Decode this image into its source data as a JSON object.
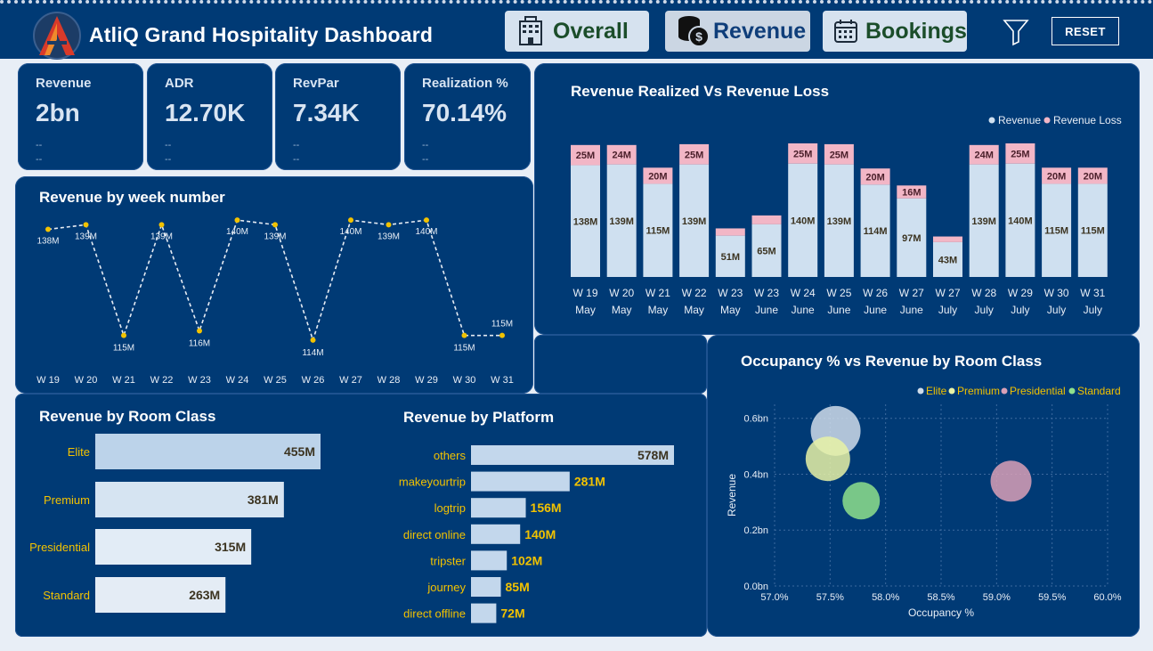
{
  "header": {
    "title": "AtliQ Grand Hospitality Dashboard",
    "nav": [
      {
        "label": "Overall",
        "icon": "hotel-icon"
      },
      {
        "label": "Revenue",
        "icon": "coins-icon"
      },
      {
        "label": "Bookings",
        "icon": "calendar-icon"
      }
    ],
    "reset_label": "RESET"
  },
  "kpis": [
    {
      "label": "Revenue",
      "value": "2bn",
      "sub1": "--",
      "sub2": "--"
    },
    {
      "label": "ADR",
      "value": "12.70K",
      "sub1": "--",
      "sub2": "--"
    },
    {
      "label": "RevPar",
      "value": "7.34K",
      "sub1": "--",
      "sub2": "--"
    },
    {
      "label": "Realization %",
      "value": "70.14%",
      "sub1": "--",
      "sub2": "--"
    }
  ],
  "chart_data": [
    {
      "id": "stacked",
      "type": "bar",
      "title": "Revenue Realized Vs Revenue Loss",
      "legend": [
        "Revenue",
        "Revenue Loss"
      ],
      "legend_colors": [
        "#cfe0f0",
        "#f2b6c6"
      ],
      "categories": [
        [
          "W 19",
          "May"
        ],
        [
          "W 20",
          "May"
        ],
        [
          "W 21",
          "May"
        ],
        [
          "W 22",
          "May"
        ],
        [
          "W 23",
          "May"
        ],
        [
          "W 23",
          "June"
        ],
        [
          "W 24",
          "June"
        ],
        [
          "W 25",
          "June"
        ],
        [
          "W 26",
          "June"
        ],
        [
          "W 27",
          "June"
        ],
        [
          "W 27",
          "July"
        ],
        [
          "W 28",
          "July"
        ],
        [
          "W 29",
          "July"
        ],
        [
          "W 30",
          "July"
        ],
        [
          "W 31",
          "July"
        ]
      ],
      "series": [
        {
          "name": "Revenue",
          "values": [
            138,
            139,
            115,
            139,
            51,
            65,
            140,
            139,
            114,
            97,
            43,
            139,
            140,
            115,
            115
          ],
          "labels": [
            "138M",
            "139M",
            "115M",
            "139M",
            "51M",
            "65M",
            "140M",
            "139M",
            "114M",
            "97M",
            "43M",
            "139M",
            "140M",
            "115M",
            "115M"
          ]
        },
        {
          "name": "Revenue Loss",
          "values": [
            25,
            24,
            20,
            25,
            9,
            11,
            25,
            25,
            20,
            16,
            7,
            24,
            25,
            20,
            20
          ],
          "labels": [
            "25M",
            "24M",
            "20M",
            "25M",
            "",
            "",
            "25M",
            "25M",
            "20M",
            "16M",
            "",
            "24M",
            "25M",
            "20M",
            "20M"
          ]
        }
      ],
      "ylim": [
        0,
        170
      ]
    },
    {
      "id": "weekline",
      "type": "line",
      "title": "Revenue by week number",
      "categories": [
        "W 19",
        "W 20",
        "W 21",
        "W 22",
        "W 23",
        "W 24",
        "W 25",
        "W 26",
        "W 27",
        "W 28",
        "W 29",
        "W 30",
        "W 31"
      ],
      "values": [
        138,
        139,
        115,
        139,
        116,
        140,
        139,
        114,
        140,
        139,
        140,
        115,
        115
      ],
      "labels": [
        "138M",
        "139M",
        "115M",
        "139M",
        "116M",
        "140M",
        "139M",
        "114M",
        "140M",
        "139M",
        "140M",
        "115M",
        "115M"
      ],
      "ylim": [
        113,
        141
      ]
    },
    {
      "id": "roomclass",
      "type": "bar",
      "title": "Revenue by Room Class",
      "categories": [
        "Elite",
        "Premium",
        "Presidential",
        "Standard"
      ],
      "values": [
        455,
        381,
        315,
        263
      ],
      "labels": [
        "455M",
        "381M",
        "315M",
        "263M"
      ],
      "colors": [
        "#bcd3ea",
        "#d6e4f2",
        "#e2ecf6",
        "#e4ecf5"
      ]
    },
    {
      "id": "platform",
      "type": "bar",
      "title": "Revenue by Platform",
      "categories": [
        "others",
        "makeyourtrip",
        "logtrip",
        "direct online",
        "tripster",
        "journey",
        "direct offline"
      ],
      "values": [
        578,
        281,
        156,
        140,
        102,
        85,
        72
      ],
      "labels": [
        "578M",
        "281M",
        "156M",
        "140M",
        "102M",
        "85M",
        "72M"
      ]
    },
    {
      "id": "bubble",
      "type": "scatter",
      "title": "Occupancy % vs Revenue by Room Class",
      "xlabel": "Occupancy %",
      "ylabel": "Revenue",
      "xlim": [
        57.0,
        60.0
      ],
      "ylim": [
        0,
        0.65
      ],
      "xticks": [
        "57.0%",
        "57.5%",
        "58.0%",
        "58.5%",
        "59.0%",
        "59.5%",
        "60.0%"
      ],
      "yticks": [
        "0.0bn",
        "0.2bn",
        "0.4bn",
        "0.6bn"
      ],
      "points": [
        {
          "name": "Elite",
          "x": 57.55,
          "y": 0.555,
          "color": "#cfdcea"
        },
        {
          "name": "Premium",
          "x": 57.48,
          "y": 0.455,
          "color": "#e8f2a6"
        },
        {
          "name": "Presidential",
          "x": 59.13,
          "y": 0.375,
          "color": "#d9a0b7"
        },
        {
          "name": "Standard",
          "x": 57.78,
          "y": 0.305,
          "color": "#8ee08c"
        }
      ]
    }
  ]
}
